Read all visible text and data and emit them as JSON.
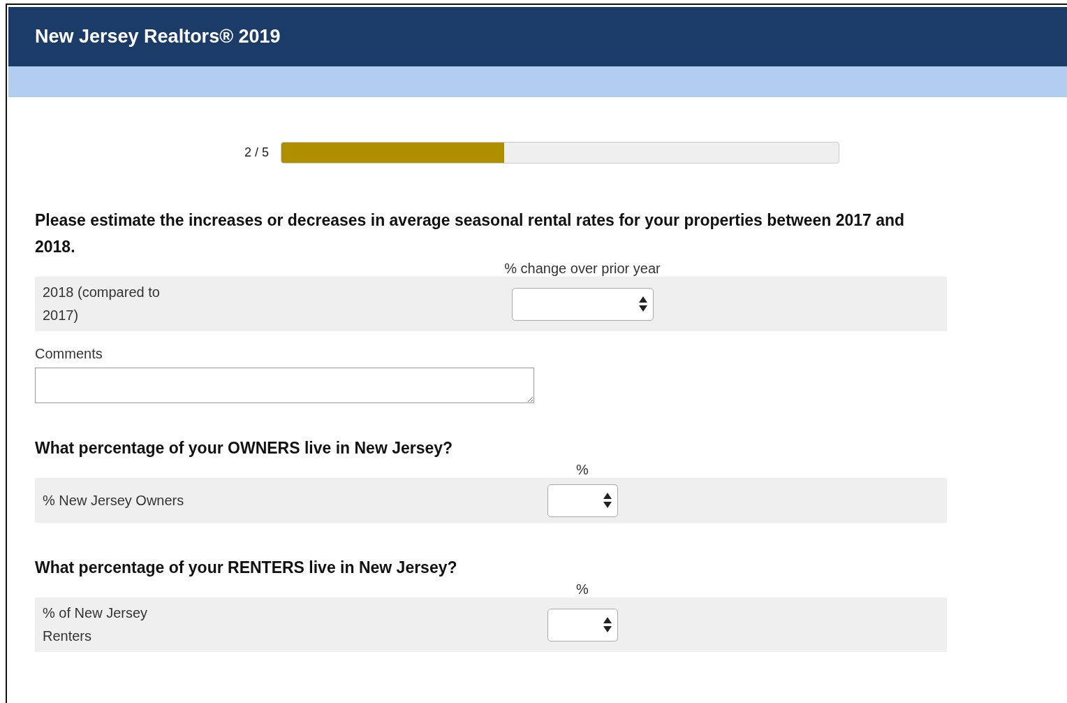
{
  "header": {
    "title": "New Jersey Realtors® 2019"
  },
  "progress": {
    "label": "2 / 5",
    "level": 0.4
  },
  "questions": [
    {
      "kind": "wide",
      "text": "Please estimate the increases or decreases in average seasonal rental rates for your properties between 2017 and 2018.",
      "column_header": "% change over prior year",
      "rows": [
        {
          "label": "2018 (compared to 2017)"
        }
      ],
      "comments": {
        "label": "Comments"
      }
    },
    {
      "kind": "narrow",
      "text": "What percentage of your OWNERS live in New Jersey?",
      "column_header": "%",
      "rows": [
        {
          "label": "% New Jersey Owners"
        }
      ]
    },
    {
      "kind": "narrow",
      "text": "What percentage of your RENTERS live in New Jersey?",
      "column_header": "%",
      "rows": [
        {
          "label": "% of New Jersey Renters"
        }
      ]
    }
  ]
}
